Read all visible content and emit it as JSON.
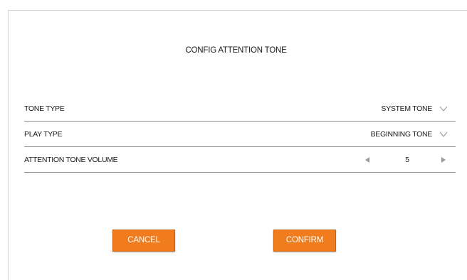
{
  "dialog": {
    "title": "CONFIG ATTENTION TONE"
  },
  "rows": [
    {
      "label": "TONE TYPE",
      "value": "SYSTEM TONE",
      "control": "dropdown"
    },
    {
      "label": "PLAY TYPE",
      "value": "BEGINNING TONE",
      "control": "dropdown"
    },
    {
      "label": "ATTENTION TONE VOLUME",
      "value": "5",
      "control": "stepper"
    }
  ],
  "buttons": {
    "cancel_label": "CANCEL",
    "confirm_label": "CONFIRM"
  },
  "icons": {
    "dropdown": "chevron-down-icon",
    "decrease": "triangle-left-icon",
    "increase": "triangle-right-icon"
  },
  "colors": {
    "button_bg": "#f07c1e",
    "button_text": "#ffffff",
    "divider": "#8c8c8c",
    "chevron": "#a0a0a0",
    "stepper_arrow": "#9a9a9a"
  }
}
